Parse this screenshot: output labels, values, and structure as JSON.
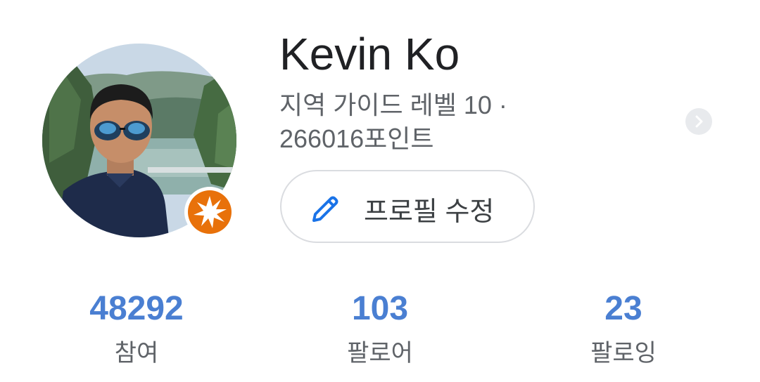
{
  "profile": {
    "name": "Kevin Ko",
    "subtitle_line1": "지역 가이드 레벨 10 ·",
    "subtitle_line2": "266016포인트",
    "avatar_icon": "profile-photo",
    "badge_icon": "local-guide-badge"
  },
  "actions": {
    "edit_profile_label": "프로필 수정",
    "edit_icon": "pencil-icon",
    "more_icon": "chevron-right-icon"
  },
  "stats": {
    "contributions": {
      "value": "48292",
      "label": "참여"
    },
    "followers": {
      "value": "103",
      "label": "팔로어"
    },
    "following": {
      "value": "23",
      "label": "팔로잉"
    }
  },
  "colors": {
    "accent": "#4a7fd2",
    "badge": "#e8710a",
    "text_primary": "#202124",
    "text_secondary": "#5f6368"
  }
}
